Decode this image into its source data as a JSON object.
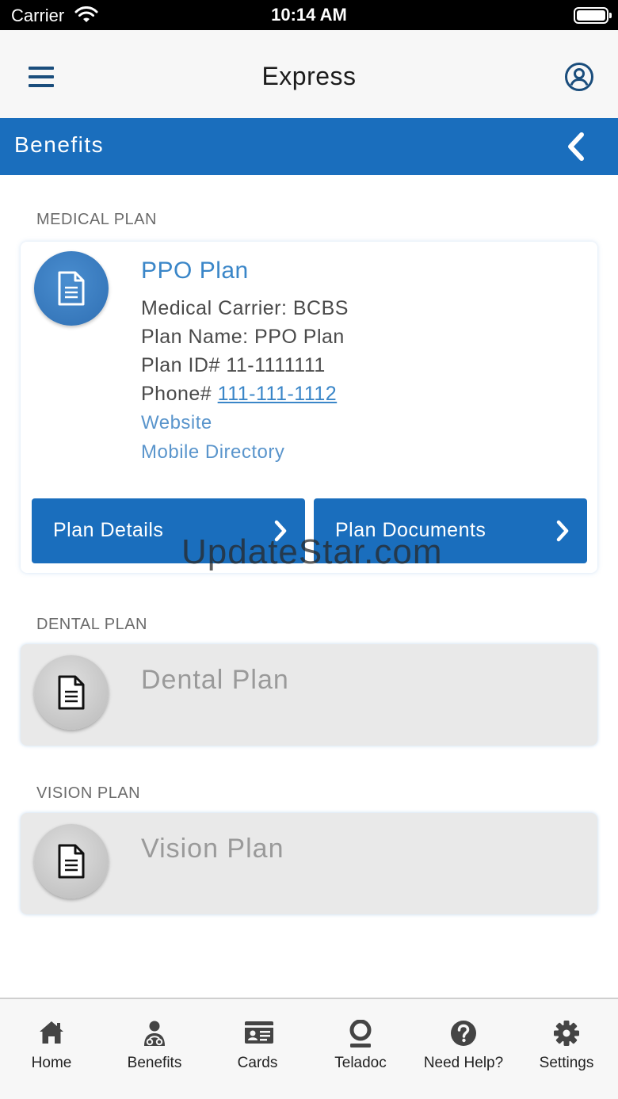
{
  "status_bar": {
    "carrier": "Carrier",
    "time": "10:14 AM"
  },
  "header": {
    "title": "Express"
  },
  "section": {
    "title": "Benefits"
  },
  "medical": {
    "label": "MEDICAL PLAN",
    "title": "PPO Plan",
    "carrier_line": "Medical Carrier: BCBS",
    "plan_name_line": "Plan Name: PPO Plan",
    "plan_id_line": "Plan ID# 11-1111111",
    "phone_prefix": "Phone# ",
    "phone": "111-111-1112",
    "website": "Website",
    "directory": "Mobile Directory",
    "details_button": "Plan Details",
    "documents_button": "Plan Documents"
  },
  "watermark": "UpdateStar.com",
  "dental": {
    "label": "DENTAL PLAN",
    "title": "Dental Plan"
  },
  "vision": {
    "label": "VISION PLAN",
    "title": "Vision Plan"
  },
  "tabs": [
    {
      "label": "Home",
      "icon": "home-icon"
    },
    {
      "label": "Benefits",
      "icon": "benefits-icon"
    },
    {
      "label": "Cards",
      "icon": "cards-icon"
    },
    {
      "label": "Teladoc",
      "icon": "teladoc-icon"
    },
    {
      "label": "Need Help?",
      "icon": "help-icon"
    },
    {
      "label": "Settings",
      "icon": "gear-icon"
    }
  ],
  "colors": {
    "brand_blue": "#1a6ebd",
    "link_blue": "#3a86c8",
    "header_icon": "#1a4d7c"
  }
}
